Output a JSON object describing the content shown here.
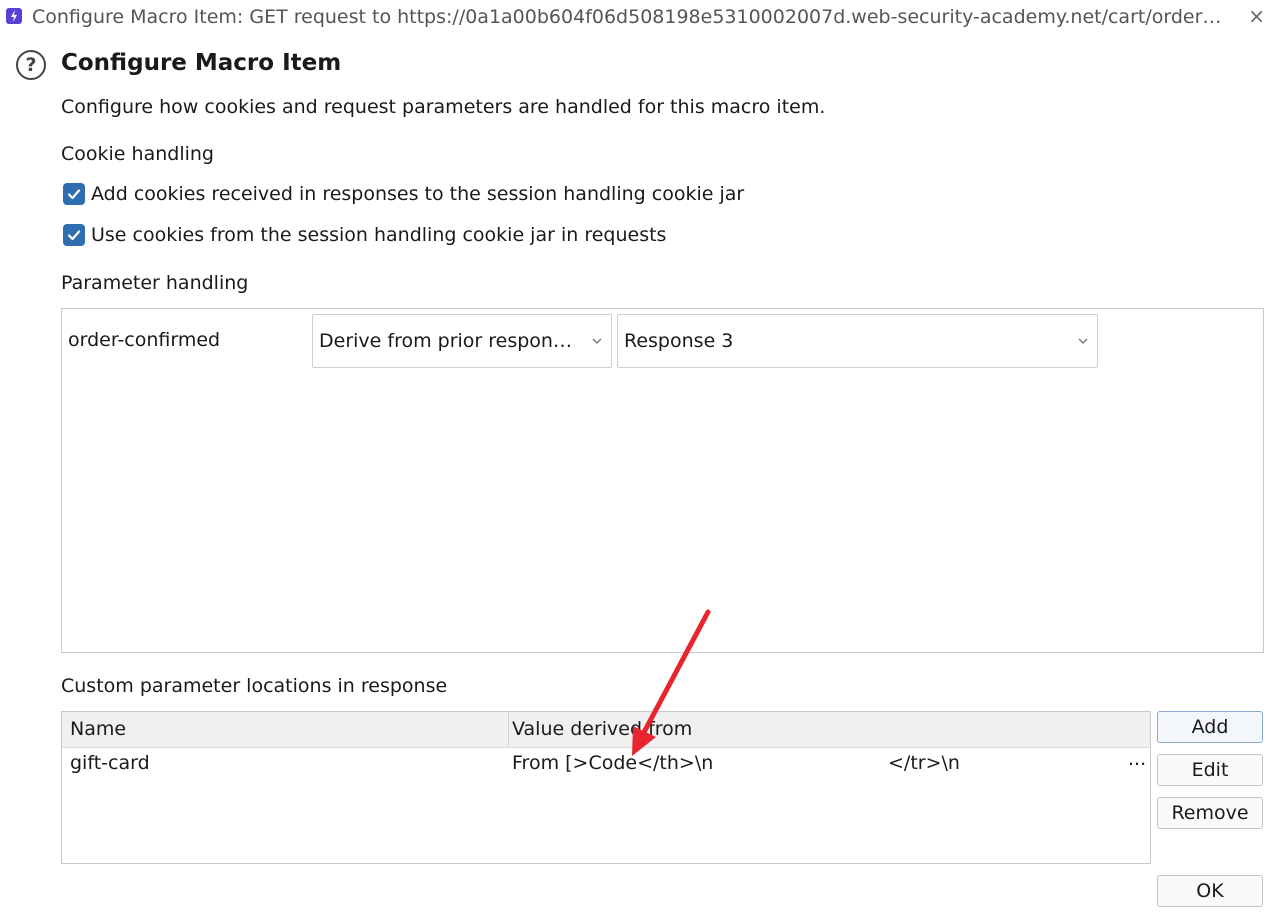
{
  "window": {
    "title": "Configure Macro Item: GET request to https://0a1a00b604f06d508198e5310002007d.web-security-academy.net/cart/order…",
    "close_icon": "×"
  },
  "dialog": {
    "help_icon": "?",
    "heading": "Configure Macro Item",
    "description": "Configure how cookies and request parameters are handled for this macro item."
  },
  "cookie_handling": {
    "label": "Cookie handling",
    "options": [
      {
        "label": "Add cookies received in responses to the session handling cookie jar",
        "checked": true
      },
      {
        "label": "Use cookies from the session handling cookie jar in requests",
        "checked": true
      }
    ]
  },
  "parameter_handling": {
    "label": "Parameter handling",
    "rows": [
      {
        "name": "order-confirmed",
        "source": "Derive from prior respon…",
        "response": "Response 3"
      }
    ]
  },
  "custom_locations": {
    "label": "Custom parameter locations in response",
    "columns": [
      "Name",
      "Value derived from"
    ],
    "rows": [
      {
        "name": "gift-card",
        "value_start": "From [>Code</th>\\n",
        "value_end": "</tr>\\n",
        "overflow": "..."
      }
    ],
    "buttons": {
      "add": "Add",
      "edit": "Edit",
      "remove": "Remove"
    }
  },
  "footer": {
    "ok": "OK"
  },
  "colors": {
    "checkbox": "#2e6db0",
    "annotation_arrow": "#e8242e",
    "app_icon": "#5b3fd4"
  }
}
